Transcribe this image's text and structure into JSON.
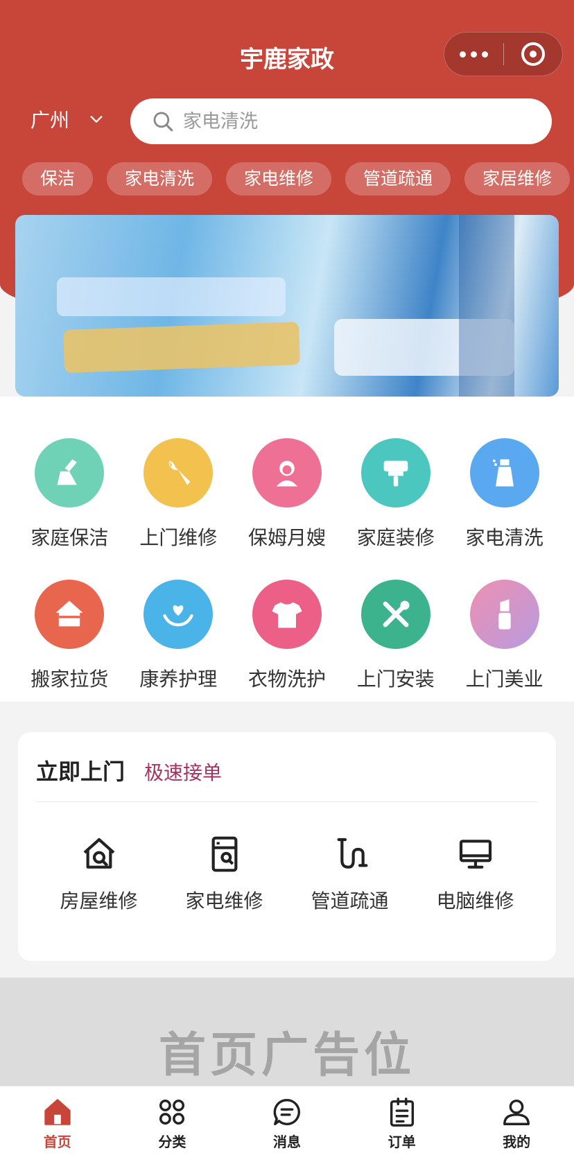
{
  "app": {
    "title": "宇鹿家政"
  },
  "colors": {
    "brand_red": "#c8453a",
    "accent_plum": "#a4345f"
  },
  "location": {
    "city": "广州"
  },
  "search": {
    "placeholder": "家电清洗"
  },
  "quick_tags": [
    "保洁",
    "家电清洗",
    "家电维修",
    "管道疏通",
    "家居维修"
  ],
  "services": [
    {
      "label": "家庭保洁",
      "icon": "broom-icon",
      "color": "#6fd1b6"
    },
    {
      "label": "上门维修",
      "icon": "wrench-icon",
      "color": "#f2c14e"
    },
    {
      "label": "保姆月嫂",
      "icon": "nanny-icon",
      "color": "#ef7095"
    },
    {
      "label": "家庭装修",
      "icon": "paint-brush-icon",
      "color": "#4cc7c0"
    },
    {
      "label": "家电清洗",
      "icon": "spray-bottle-icon",
      "color": "#5aa9f0"
    },
    {
      "label": "搬家拉货",
      "icon": "house-icon",
      "color": "#e9664e"
    },
    {
      "label": "康养护理",
      "icon": "heart-hands-icon",
      "color": "#4ab3e8"
    },
    {
      "label": "衣物洗护",
      "icon": "tshirt-icon",
      "color": "#ec5f86"
    },
    {
      "label": "上门安装",
      "icon": "tools-icon",
      "color": "#3cb38c"
    },
    {
      "label": "上门美业",
      "icon": "lipstick-icon",
      "color": "#d48fc6"
    }
  ],
  "quick_service": {
    "title": "立即上门",
    "subtitle": "极速接单",
    "items": [
      {
        "label": "房屋维修",
        "icon": "house-repair-icon"
      },
      {
        "label": "家电维修",
        "icon": "appliance-repair-icon"
      },
      {
        "label": "管道疏通",
        "icon": "pipe-icon"
      },
      {
        "label": "电脑维修",
        "icon": "computer-icon"
      }
    ]
  },
  "ad": {
    "text": "首页广告位"
  },
  "tabbar": [
    {
      "label": "首页",
      "icon": "home-icon",
      "active": true
    },
    {
      "label": "分类",
      "icon": "category-icon",
      "active": false
    },
    {
      "label": "消息",
      "icon": "message-icon",
      "active": false
    },
    {
      "label": "订单",
      "icon": "order-icon",
      "active": false
    },
    {
      "label": "我的",
      "icon": "profile-icon",
      "active": false
    }
  ]
}
